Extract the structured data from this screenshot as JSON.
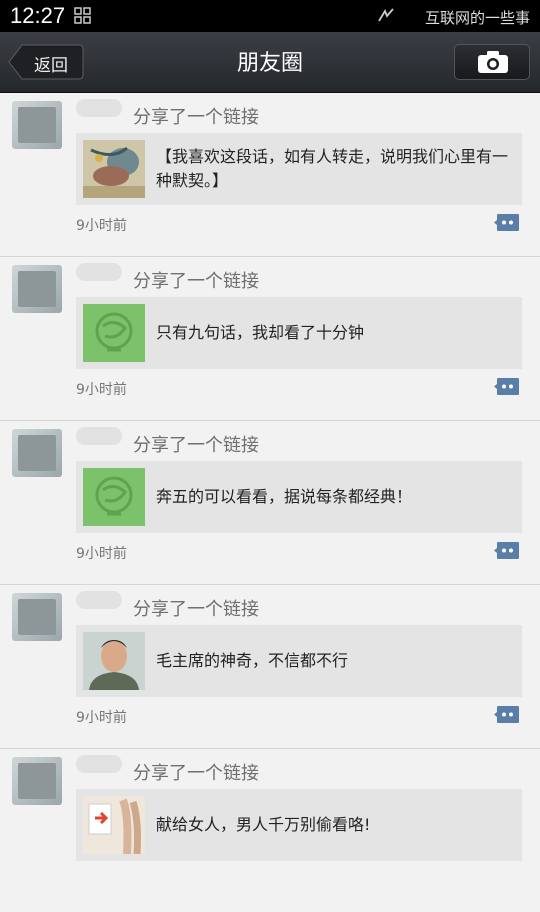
{
  "statusbar": {
    "time": "12:27",
    "watermark": "互联网的一些事"
  },
  "header": {
    "back_label": "返回",
    "title": "朋友圈",
    "camera_icon": "camera-icon"
  },
  "posts": [
    {
      "action": "分享了一个链接",
      "link_text": "【我喜欢这段话，如有人转走，说明我们心里有一种默契。】",
      "time": "9小时前",
      "thumb": "painting"
    },
    {
      "action": "分享了一个链接",
      "link_text": "只有九句话，我却看了十分钟",
      "time": "9小时前",
      "thumb": "green-logo"
    },
    {
      "action": "分享了一个链接",
      "link_text": "奔五的可以看看，据说每条都经典！",
      "time": "9小时前",
      "thumb": "green-logo"
    },
    {
      "action": "分享了一个链接",
      "link_text": "毛主席的神奇，不信都不行",
      "time": "9小时前",
      "thumb": "portrait"
    },
    {
      "action": "分享了一个链接",
      "link_text": "献给女人，男人千万别偷看咯!",
      "time": "",
      "thumb": "sign"
    }
  ],
  "colors": {
    "titlebar": "#2f3237",
    "link_box": "#e4e4e4",
    "green_thumb": "#7cc26a",
    "comment_icon": "#5b7ea8"
  }
}
